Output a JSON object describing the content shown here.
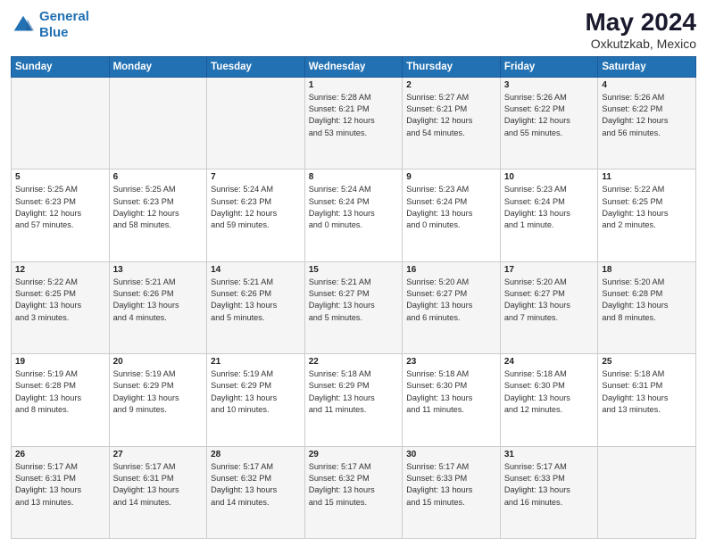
{
  "header": {
    "logo_line1": "General",
    "logo_line2": "Blue",
    "month": "May 2024",
    "location": "Oxkutzkab, Mexico"
  },
  "weekdays": [
    "Sunday",
    "Monday",
    "Tuesday",
    "Wednesday",
    "Thursday",
    "Friday",
    "Saturday"
  ],
  "rows": [
    [
      {
        "day": "",
        "info": ""
      },
      {
        "day": "",
        "info": ""
      },
      {
        "day": "",
        "info": ""
      },
      {
        "day": "1",
        "info": "Sunrise: 5:28 AM\nSunset: 6:21 PM\nDaylight: 12 hours\nand 53 minutes."
      },
      {
        "day": "2",
        "info": "Sunrise: 5:27 AM\nSunset: 6:21 PM\nDaylight: 12 hours\nand 54 minutes."
      },
      {
        "day": "3",
        "info": "Sunrise: 5:26 AM\nSunset: 6:22 PM\nDaylight: 12 hours\nand 55 minutes."
      },
      {
        "day": "4",
        "info": "Sunrise: 5:26 AM\nSunset: 6:22 PM\nDaylight: 12 hours\nand 56 minutes."
      }
    ],
    [
      {
        "day": "5",
        "info": "Sunrise: 5:25 AM\nSunset: 6:23 PM\nDaylight: 12 hours\nand 57 minutes."
      },
      {
        "day": "6",
        "info": "Sunrise: 5:25 AM\nSunset: 6:23 PM\nDaylight: 12 hours\nand 58 minutes."
      },
      {
        "day": "7",
        "info": "Sunrise: 5:24 AM\nSunset: 6:23 PM\nDaylight: 12 hours\nand 59 minutes."
      },
      {
        "day": "8",
        "info": "Sunrise: 5:24 AM\nSunset: 6:24 PM\nDaylight: 13 hours\nand 0 minutes."
      },
      {
        "day": "9",
        "info": "Sunrise: 5:23 AM\nSunset: 6:24 PM\nDaylight: 13 hours\nand 0 minutes."
      },
      {
        "day": "10",
        "info": "Sunrise: 5:23 AM\nSunset: 6:24 PM\nDaylight: 13 hours\nand 1 minute."
      },
      {
        "day": "11",
        "info": "Sunrise: 5:22 AM\nSunset: 6:25 PM\nDaylight: 13 hours\nand 2 minutes."
      }
    ],
    [
      {
        "day": "12",
        "info": "Sunrise: 5:22 AM\nSunset: 6:25 PM\nDaylight: 13 hours\nand 3 minutes."
      },
      {
        "day": "13",
        "info": "Sunrise: 5:21 AM\nSunset: 6:26 PM\nDaylight: 13 hours\nand 4 minutes."
      },
      {
        "day": "14",
        "info": "Sunrise: 5:21 AM\nSunset: 6:26 PM\nDaylight: 13 hours\nand 5 minutes."
      },
      {
        "day": "15",
        "info": "Sunrise: 5:21 AM\nSunset: 6:27 PM\nDaylight: 13 hours\nand 5 minutes."
      },
      {
        "day": "16",
        "info": "Sunrise: 5:20 AM\nSunset: 6:27 PM\nDaylight: 13 hours\nand 6 minutes."
      },
      {
        "day": "17",
        "info": "Sunrise: 5:20 AM\nSunset: 6:27 PM\nDaylight: 13 hours\nand 7 minutes."
      },
      {
        "day": "18",
        "info": "Sunrise: 5:20 AM\nSunset: 6:28 PM\nDaylight: 13 hours\nand 8 minutes."
      }
    ],
    [
      {
        "day": "19",
        "info": "Sunrise: 5:19 AM\nSunset: 6:28 PM\nDaylight: 13 hours\nand 8 minutes."
      },
      {
        "day": "20",
        "info": "Sunrise: 5:19 AM\nSunset: 6:29 PM\nDaylight: 13 hours\nand 9 minutes."
      },
      {
        "day": "21",
        "info": "Sunrise: 5:19 AM\nSunset: 6:29 PM\nDaylight: 13 hours\nand 10 minutes."
      },
      {
        "day": "22",
        "info": "Sunrise: 5:18 AM\nSunset: 6:29 PM\nDaylight: 13 hours\nand 11 minutes."
      },
      {
        "day": "23",
        "info": "Sunrise: 5:18 AM\nSunset: 6:30 PM\nDaylight: 13 hours\nand 11 minutes."
      },
      {
        "day": "24",
        "info": "Sunrise: 5:18 AM\nSunset: 6:30 PM\nDaylight: 13 hours\nand 12 minutes."
      },
      {
        "day": "25",
        "info": "Sunrise: 5:18 AM\nSunset: 6:31 PM\nDaylight: 13 hours\nand 13 minutes."
      }
    ],
    [
      {
        "day": "26",
        "info": "Sunrise: 5:17 AM\nSunset: 6:31 PM\nDaylight: 13 hours\nand 13 minutes."
      },
      {
        "day": "27",
        "info": "Sunrise: 5:17 AM\nSunset: 6:31 PM\nDaylight: 13 hours\nand 14 minutes."
      },
      {
        "day": "28",
        "info": "Sunrise: 5:17 AM\nSunset: 6:32 PM\nDaylight: 13 hours\nand 14 minutes."
      },
      {
        "day": "29",
        "info": "Sunrise: 5:17 AM\nSunset: 6:32 PM\nDaylight: 13 hours\nand 15 minutes."
      },
      {
        "day": "30",
        "info": "Sunrise: 5:17 AM\nSunset: 6:33 PM\nDaylight: 13 hours\nand 15 minutes."
      },
      {
        "day": "31",
        "info": "Sunrise: 5:17 AM\nSunset: 6:33 PM\nDaylight: 13 hours\nand 16 minutes."
      },
      {
        "day": "",
        "info": ""
      }
    ]
  ]
}
